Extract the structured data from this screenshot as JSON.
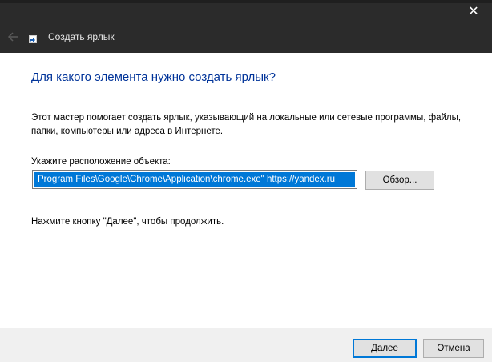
{
  "window": {
    "title": "Создать ярлык",
    "close_symbol": "✕",
    "icons": {
      "back": "back-arrow-icon",
      "app": "shortcut-icon",
      "close": "close-icon"
    }
  },
  "wizard": {
    "heading": "Для какого элемента нужно создать ярлык?",
    "description": "Этот мастер помогает создать ярлык, указывающий на локальные или сетевые программы, файлы, папки, компьютеры или адреса в Интернете.",
    "location_label": "Укажите расположение объекта:",
    "location_value": "Program Files\\Google\\Chrome\\Application\\chrome.exe\" https://yandex.ru",
    "browse_label": "Обзор...",
    "hint": "Нажмите кнопку \"Далее\", чтобы продолжить."
  },
  "footer": {
    "next_label": "Далее",
    "cancel_label": "Отмена"
  },
  "colors": {
    "titlebar": "#2b2b2b",
    "heading": "#003399",
    "selection": "#0078d7",
    "footer": "#f0f0f0"
  }
}
